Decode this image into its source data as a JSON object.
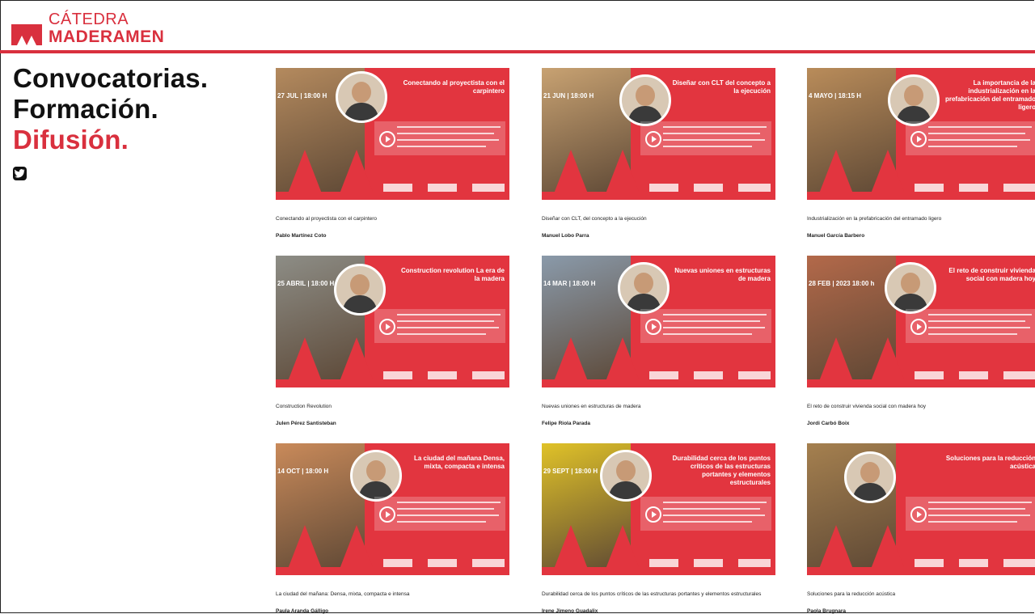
{
  "brand": {
    "top": "CÁTEDRA",
    "bottom": "MADERAMEN",
    "color": "#d9303e"
  },
  "tagline": [
    "Convocatorias.",
    "Formación.",
    "Difusión."
  ],
  "social": {
    "icon": "twitter-icon"
  },
  "cards": [
    {
      "thumb_title": "Conectando al proyectista con el carpintero",
      "thumb_date": "27 JUL | 18:00 H",
      "title": "Conectando al proyectista con el carpintero",
      "author": "Pablo Martínez Coto",
      "photo_color": "#b48a5e"
    },
    {
      "thumb_title": "Diseñar con CLT del concepto a la ejecución",
      "thumb_date": "21 JUN | 18:00 H",
      "title": "Diseñar con CLT, del concepto a la ejecución",
      "author": "Manuel Lobo Parra",
      "photo_color": "#c8a272"
    },
    {
      "thumb_title": "La importancia de la industrialización en la prefabricación del entramado ligero",
      "thumb_date": "4 MAYO | 18:15 H",
      "title": "Industrialización en la prefabricación del entramado ligero",
      "author": "Manuel García Barbero",
      "photo_color": "#b98c5a"
    },
    {
      "thumb_title": "Construction revolution La era de la madera",
      "thumb_date": "25 ABRIL | 18:00 H",
      "title": "Construction Revolution",
      "author": "Julen Pérez Santisteban",
      "photo_color": "#8d8d86"
    },
    {
      "thumb_title": "Nuevas uniones en estructuras de madera",
      "thumb_date": "14 MAR | 18:00 H",
      "title": "Nuevas uniones en estructuras de madera",
      "author": "Felipe Riola Parada",
      "photo_color": "#8a9aaa"
    },
    {
      "thumb_title": "El reto de construir vivienda social con madera hoy",
      "thumb_date": "28 FEB | 2023 18:00 h",
      "title": "El reto de construir vivienda social con madera hoy",
      "author": "Jordi Carbó Boix",
      "photo_color": "#b3694a"
    },
    {
      "thumb_title": "La ciudad del mañana Densa, mixta, compacta e intensa",
      "thumb_date": "14 OCT | 18:00 H",
      "title": "La ciudad del mañana: Densa, mixta, compacta e intensa",
      "author": "Paula Aranda Gálligo",
      "photo_color": "#c98a5a"
    },
    {
      "thumb_title": "Durabilidad cerca de los puntos críticos de las estructuras portantes y elementos estructurales",
      "thumb_date": "29 SEPT | 18:00 H",
      "title": "Durabilidad cerca de los puntos críticos de las estructuras portantes y elementos estructurales",
      "author": "Irene Jimeno Guadalix",
      "photo_color": "#e0c228"
    },
    {
      "thumb_title": "Soluciones para la reducción acústica",
      "thumb_date": "",
      "title": "Soluciones para la reducción acústica",
      "author": "Paola Brugnara",
      "photo_color": "#a5804f"
    }
  ]
}
